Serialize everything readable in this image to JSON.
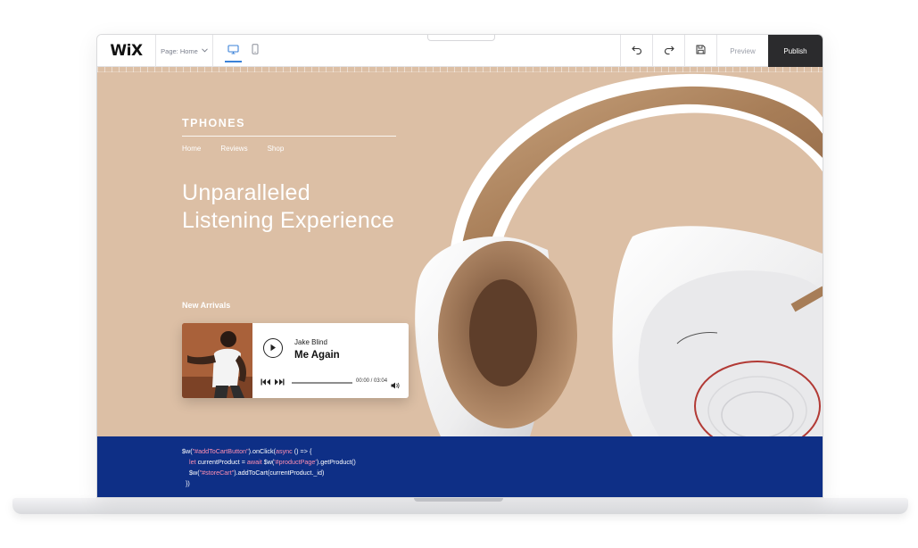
{
  "editor": {
    "logo": "WiX",
    "page_select": "Page: Home",
    "preview_label": "Preview",
    "publish_label": "Publish",
    "icons": {
      "desktop": "desktop-icon",
      "mobile": "mobile-icon",
      "undo": "undo-icon",
      "redo": "redo-icon",
      "save": "save-icon",
      "chevron": "chevron-down-icon"
    },
    "accent": "#3b82d8"
  },
  "site": {
    "brand": "TPHONES",
    "nav": [
      "Home",
      "Reviews",
      "Shop"
    ],
    "headline_line1": "Unparalleled",
    "headline_line2": "Listening Experience",
    "section_title": "New Arrivals",
    "background_color": "#dcbfa5"
  },
  "player": {
    "artist": "Jake Blind",
    "track": "Me Again",
    "time": "00:00 / 03:04",
    "progress": 0
  },
  "code": {
    "line1_a": "$w(",
    "line1_str": "\"#addToCartButton\"",
    "line1_b": ").onClick(",
    "line1_kw": "async",
    "line1_c": " () => {",
    "line2_kw1": "let",
    "line2_a": " currentProduct = ",
    "line2_kw2": "await",
    "line2_b": " $w(",
    "line2_str": "'#productPage'",
    "line2_c": ").getProduct()",
    "line3_a": "$w(",
    "line3_str": "\"#storeCart\"",
    "line3_b": ").addToCart(currentProduct._id)",
    "line4": "})",
    "background_color": "#0e2f86"
  }
}
